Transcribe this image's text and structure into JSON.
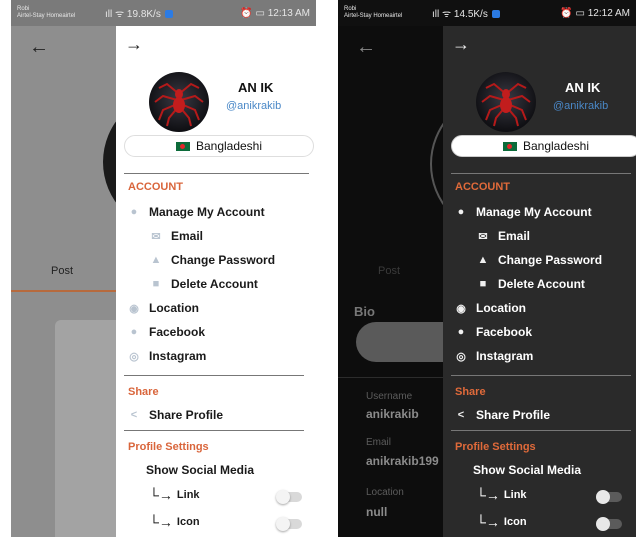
{
  "screens": [
    {
      "theme": "light",
      "status": {
        "carrier_line1": "Robi",
        "carrier_line2": "Airtel-Stay Homeairtel",
        "speed": "19.8K/s",
        "time": "12:13 AM"
      },
      "background": {
        "tab_label": "Post"
      },
      "drawer": {
        "name": "AN IK",
        "handle": "@anikrakib",
        "nationality": "Bangladeshi",
        "account_title": "ACCOUNT",
        "manage_account": "Manage My Account",
        "email": "Email",
        "change_password": "Change Password",
        "delete_account": "Delete Account",
        "location": "Location",
        "facebook": "Facebook",
        "instagram": "Instagram",
        "share_title": "Share",
        "share_profile": "Share Profile",
        "profile_settings_title": "Profile Settings",
        "show_social_media": "Show Social Media",
        "link": "Link",
        "icon": "Icon"
      }
    },
    {
      "theme": "dark",
      "status": {
        "carrier_line1": "Robi",
        "carrier_line2": "Airtel-Stay Homeairtel",
        "speed": "14.5K/s",
        "time": "12:12 AM"
      },
      "background": {
        "tab_label": "Post",
        "bio_label": "Bio",
        "username_label": "Username",
        "username_value": "anikrakib",
        "email_label": "Email",
        "email_value": "anikrakib199",
        "location_label": "Location",
        "location_value": "null"
      },
      "drawer": {
        "name": "AN IK",
        "handle": "@anikrakib",
        "nationality": "Bangladeshi",
        "account_title": "ACCOUNT",
        "manage_account": "Manage My Account",
        "email": "Email",
        "change_password": "Change Password",
        "delete_account": "Delete Account",
        "location": "Location",
        "facebook": "Facebook",
        "instagram": "Instagram",
        "share_title": "Share",
        "share_profile": "Share Profile",
        "profile_settings_title": "Profile Settings",
        "show_social_media": "Show Social Media",
        "link": "Link",
        "icon": "Icon"
      }
    }
  ],
  "colors": {
    "accent": "#d9653b",
    "handle": "#4a88c7",
    "flag_green": "#0c6b3a",
    "flag_red": "#e3262a"
  },
  "icons": [
    "back-arrow-icon",
    "drawer-arrow-icon",
    "spider-avatar",
    "person-icon",
    "mail-icon",
    "lock-icon",
    "trash-icon",
    "location-pin-icon",
    "facebook-icon",
    "instagram-icon",
    "share-icon",
    "toggle-switch"
  ]
}
